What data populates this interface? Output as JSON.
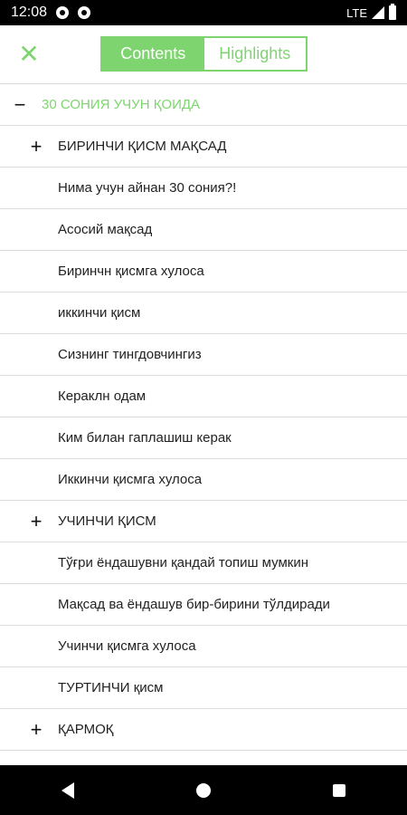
{
  "status": {
    "time": "12:08",
    "network": "LTE",
    "icons": [
      "settings-icon",
      "settings-icon",
      "signal-icon",
      "battery-icon"
    ]
  },
  "header": {
    "close_icon": "close-icon",
    "tabs": [
      {
        "label": "Contents",
        "active": true
      },
      {
        "label": "Highlights",
        "active": false
      }
    ]
  },
  "toc": {
    "items": [
      {
        "label": "30 СОНИЯ УЧУН ҚОИДА",
        "level": 0,
        "sign": "−"
      },
      {
        "label": "БИРИНЧИ ҚИСМ МАҚСАД",
        "level": 1,
        "sign": "+"
      },
      {
        "label": "Нима учун айнан 30 сония?!",
        "level": 2,
        "sign": ""
      },
      {
        "label": "Асосий мақсад",
        "level": 2,
        "sign": ""
      },
      {
        "label": "Биринчн қисмга хулоса",
        "level": 2,
        "sign": ""
      },
      {
        "label": "иккинчи қисм",
        "level": 2,
        "sign": ""
      },
      {
        "label": "Сизнинг тингдовчингиз",
        "level": 2,
        "sign": ""
      },
      {
        "label": "Кераклн одам",
        "level": 2,
        "sign": ""
      },
      {
        "label": "Ким билан гаплашиш керак",
        "level": 2,
        "sign": ""
      },
      {
        "label": "Иккинчи қисмга хулоса",
        "level": 2,
        "sign": ""
      },
      {
        "label": "УЧИНЧИ ҚИСМ",
        "level": 1,
        "sign": "+"
      },
      {
        "label": "Тўғри ёндашувни қандай топиш мумкин",
        "level": 2,
        "sign": ""
      },
      {
        "label": "Мақсад ва ёндашув бир-бирини тўлдиради",
        "level": 2,
        "sign": ""
      },
      {
        "label": "Учинчи қисмга хулоса",
        "level": 2,
        "sign": ""
      },
      {
        "label": "ТУРТИНЧИ қисм",
        "level": 2,
        "sign": ""
      },
      {
        "label": "ҚАРМОҚ",
        "level": 1,
        "sign": "+"
      }
    ]
  },
  "colors": {
    "accent": "#7ed56f",
    "divider": "#dcdcdc"
  }
}
